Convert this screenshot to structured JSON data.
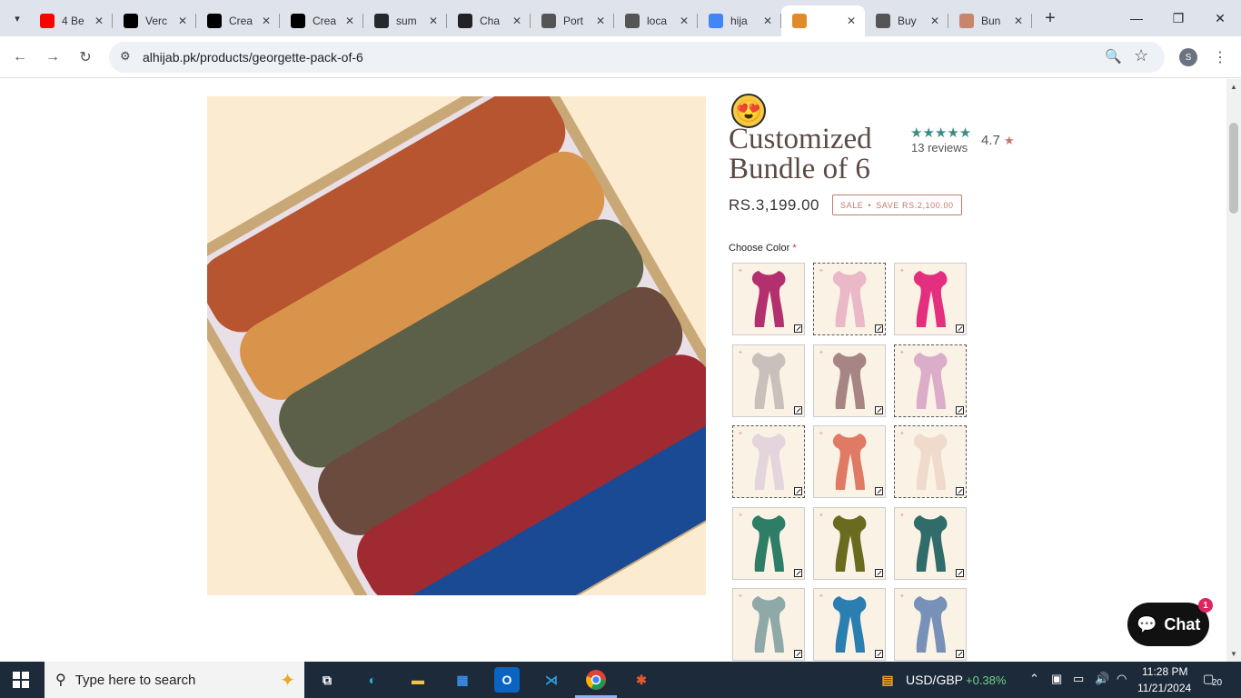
{
  "browser": {
    "tabs": [
      {
        "label": "4 Be",
        "favicon": "youtube-icon",
        "color": "#ff0000"
      },
      {
        "label": "Verc",
        "favicon": "vercel-icon",
        "color": "#000000"
      },
      {
        "label": "Crea",
        "favicon": "vercel-icon",
        "color": "#000000"
      },
      {
        "label": "Crea",
        "favicon": "vercel-icon",
        "color": "#000000"
      },
      {
        "label": "sum",
        "favicon": "github-icon",
        "color": "#24292e"
      },
      {
        "label": "Cha",
        "favicon": "chatgpt-icon",
        "color": "#222222"
      },
      {
        "label": "Port",
        "favicon": "openai-icon",
        "color": "#555555"
      },
      {
        "label": "loca",
        "favicon": "globe-icon",
        "color": "#555555"
      },
      {
        "label": "hija",
        "favicon": "google-icon",
        "color": "#4285f4"
      },
      {
        "label": "",
        "favicon": "alhijab-icon",
        "color": "#e08a2a",
        "active": true
      },
      {
        "label": "Buy",
        "favicon": "globe-icon",
        "color": "#555555"
      },
      {
        "label": "Bun",
        "favicon": "avatar-icon",
        "color": "#c9856a"
      }
    ],
    "url": "alhijab.pk/products/georgette-pack-of-6",
    "profile_initial": "S"
  },
  "product": {
    "title": "Customized Bundle of 6",
    "rating": "4.7",
    "reviews": "13 reviews",
    "price": "RS.3,199.00",
    "sale_label": "SALE",
    "save_label": "SAVE RS.2,100.00",
    "choose_color_label": "Choose Color",
    "required_mark": "*",
    "image_colors": [
      "#b6552f",
      "#d9944c",
      "#5d6048",
      "#6a4b3d",
      "#a02a31",
      "#1b4a94"
    ],
    "swatches": [
      {
        "color": "#b3306e",
        "dashed": false
      },
      {
        "color": "#eab8c6",
        "dashed": true
      },
      {
        "color": "#e42f7e",
        "dashed": false
      },
      {
        "color": "#c9bfbb",
        "dashed": false
      },
      {
        "color": "#a88585",
        "dashed": false
      },
      {
        "color": "#dcadc9",
        "dashed": true
      },
      {
        "color": "#e4d4dc",
        "dashed": true
      },
      {
        "color": "#e07a64",
        "dashed": false
      },
      {
        "color": "#efdacc",
        "dashed": true
      },
      {
        "color": "#2e7d66",
        "dashed": false
      },
      {
        "color": "#6a6b1e",
        "dashed": false
      },
      {
        "color": "#2f6c6a",
        "dashed": false
      },
      {
        "color": "#8ea9a7",
        "dashed": false
      },
      {
        "color": "#2a7fb0",
        "dashed": false
      },
      {
        "color": "#7791b8",
        "dashed": false
      }
    ]
  },
  "chat": {
    "label": "Chat",
    "badge": "1"
  },
  "taskbar": {
    "search_placeholder": "Type here to search",
    "ticker": "USD/GBP",
    "ticker_change": "+0.38%",
    "time": "11:28 PM",
    "date": "11/21/2024",
    "notifications": "20"
  }
}
